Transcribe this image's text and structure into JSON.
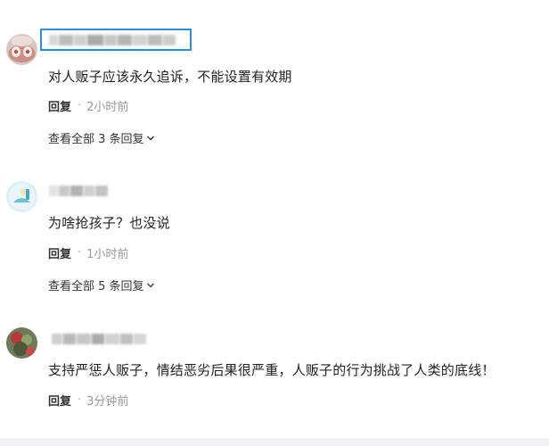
{
  "comments": [
    {
      "content": "对人贩子应该永久追诉，不能设置有效期",
      "reply_label": "回复",
      "time": "2小时前",
      "view_replies": "查看全部 3 条回复"
    },
    {
      "content": "为啥抢孩子？也没说",
      "reply_label": "回复",
      "time": "1小时前",
      "view_replies": "查看全部 5 条回复"
    },
    {
      "content": "支持严惩人贩子，情结恶劣后果很严重，人贩子的行为挑战了人类的底线！",
      "reply_label": "回复",
      "time": "3分钟前"
    }
  ],
  "icons": {
    "separator": "·",
    "expand": "chevron-down-icon"
  },
  "colors": {
    "highlight": "#2a8fd6",
    "meta": "#999999",
    "text": "#222222"
  }
}
